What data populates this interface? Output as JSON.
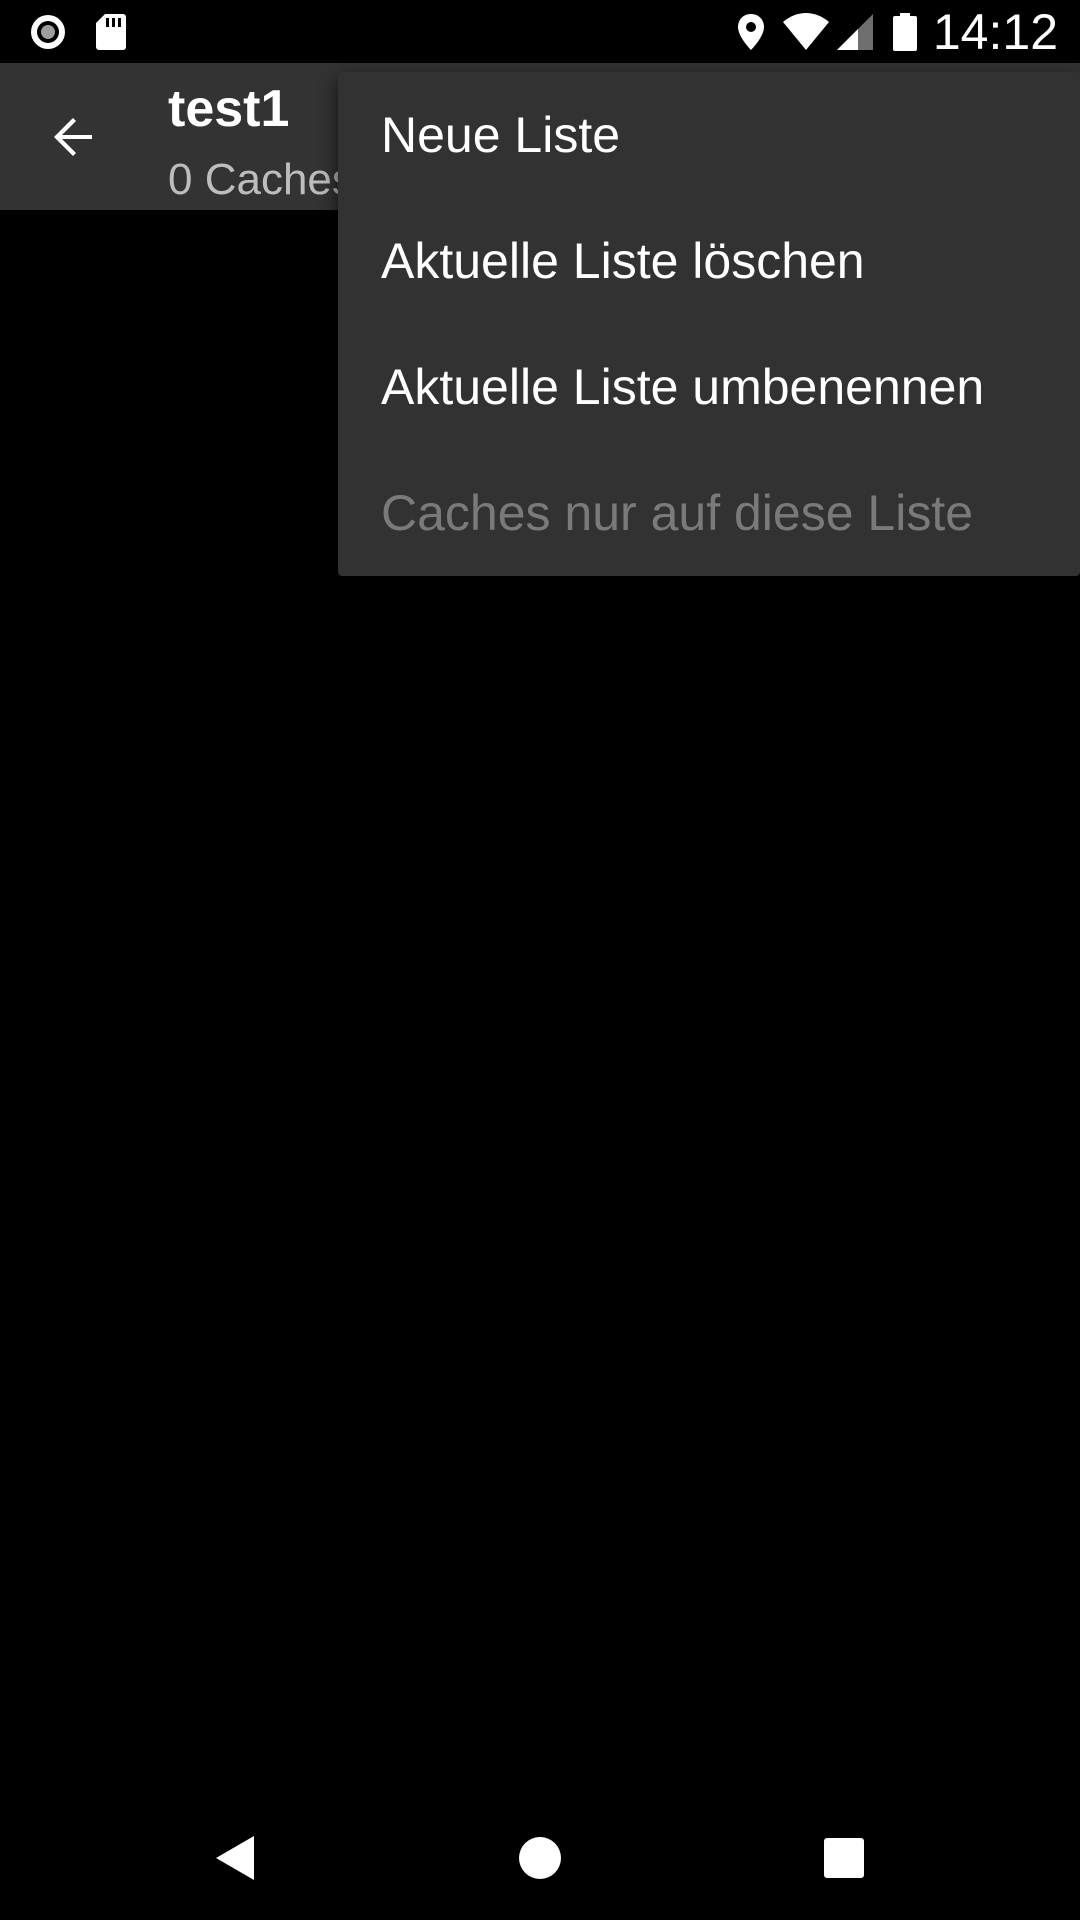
{
  "status_bar": {
    "time": "14:12",
    "icons": [
      "record-icon",
      "sd-card-icon",
      "location-icon",
      "wifi-icon",
      "cell-signal-icon",
      "battery-icon"
    ]
  },
  "toolbar": {
    "title": "test1",
    "subtitle": "0 Caches",
    "back_icon": "arrow-back-icon"
  },
  "menu": {
    "items": [
      {
        "label": "Neue Liste",
        "enabled": true
      },
      {
        "label": "Aktuelle Liste löschen",
        "enabled": true
      },
      {
        "label": "Aktuelle Liste umbenennen",
        "enabled": true
      },
      {
        "label": "Caches nur auf diese Liste",
        "enabled": false
      }
    ]
  },
  "nav_bar": {
    "icons": [
      "nav-back-icon",
      "nav-home-icon",
      "nav-recents-icon"
    ]
  },
  "colors": {
    "toolbar_bg": "#333333",
    "menu_bg": "#323232",
    "background": "#000000",
    "text_primary": "#ffffff",
    "text_disabled": "#7a7a7a"
  }
}
